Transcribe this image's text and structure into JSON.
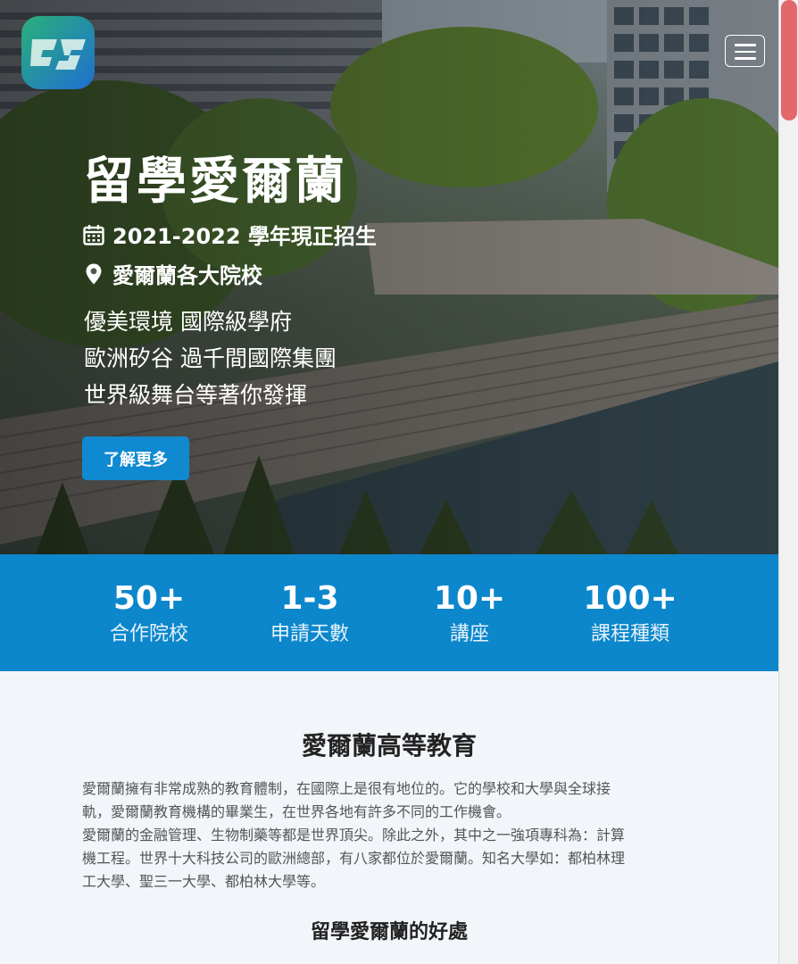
{
  "header": {
    "logo_icon": "brand-logo-icon",
    "menu_icon": "hamburger-menu-icon"
  },
  "hero": {
    "title": "留學愛爾蘭",
    "date_text": "2021-2022 學年現正招生",
    "location_text": "愛爾蘭各大院校",
    "lines": [
      "優美環境 國際級學府",
      "歐洲矽谷 過千間國際集團",
      "世界級舞台等著你發揮"
    ],
    "cta_label": "了解更多"
  },
  "stats": [
    {
      "value": "50+",
      "label": "合作院校"
    },
    {
      "value": "1-3",
      "label": "申請天數"
    },
    {
      "value": "10+",
      "label": "講座"
    },
    {
      "value": "100+",
      "label": "課程種類"
    }
  ],
  "content": {
    "title": "愛爾蘭高等教育",
    "paragraph1_line1": "愛爾蘭擁有非常成熟的教育體制，在國際上是很有地位的。它的學校和大學與全球接",
    "paragraph1_line2": "軌，愛爾蘭教育機構的畢業生，在世界各地有許多不同的工作機會。",
    "paragraph2_line1": "愛爾蘭的金融管理、生物制藥等都是世界頂尖。除此之外，其中之一強項專科為：計算",
    "paragraph2_line2": "機工程。世界十大科技公司的歐洲總部，有八家都位於愛爾蘭。知名大學如：都柏林理",
    "paragraph2_line3": "工大學、聖三一大學、都柏林大學等。",
    "subtitle": "留學愛爾蘭的好處"
  },
  "colors": {
    "accent": "#0c87cc",
    "cta": "#0f8ad0",
    "scroll_thumb": "#e2686b",
    "content_bg": "#f2f6fa"
  }
}
